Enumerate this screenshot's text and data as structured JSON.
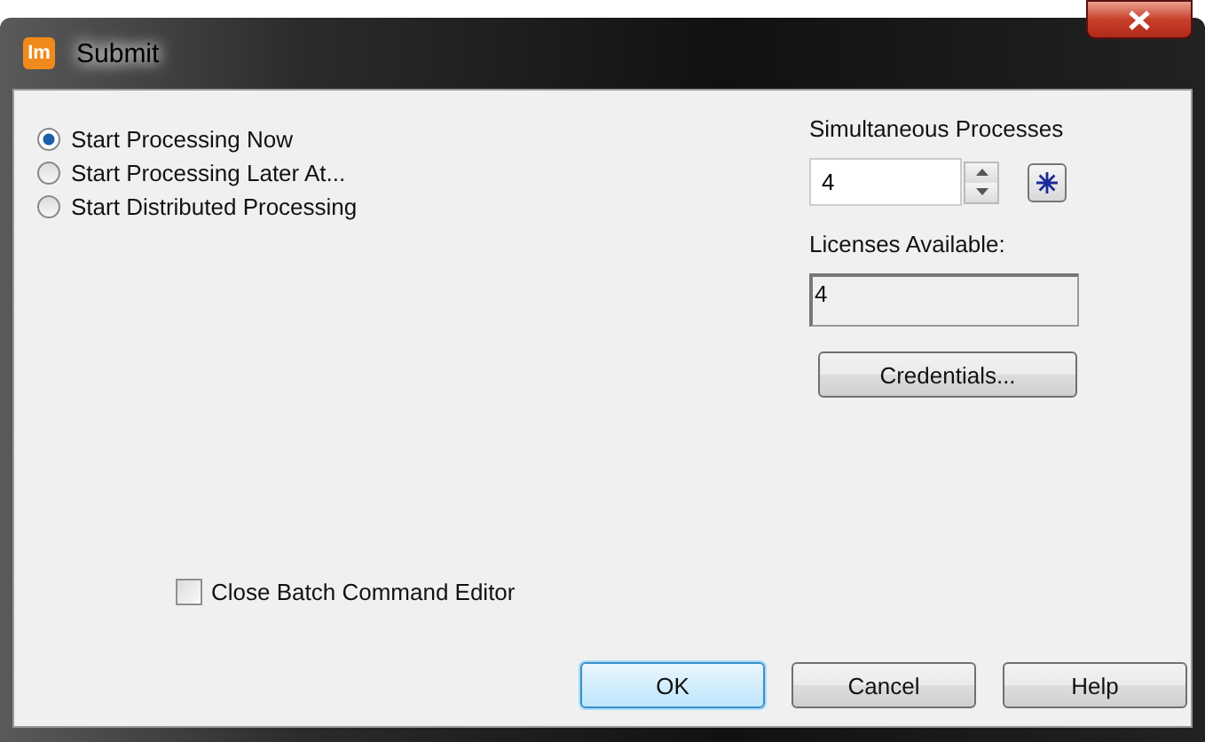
{
  "window": {
    "title": "Submit",
    "app_icon": "Im"
  },
  "processing_options": [
    {
      "label": "Start Processing Now",
      "selected": true
    },
    {
      "label": "Start Processing Later At...",
      "selected": false
    },
    {
      "label": "Start Distributed Processing",
      "selected": false
    }
  ],
  "simultaneous_processes": {
    "label": "Simultaneous Processes",
    "value": "4"
  },
  "licenses_available": {
    "label": "Licenses Available:",
    "value": "4"
  },
  "credentials_button": "Credentials...",
  "close_editor": {
    "label": "Close Batch Command Editor",
    "checked": false
  },
  "buttons": [
    {
      "label": "OK",
      "default": true
    },
    {
      "label": "Cancel",
      "default": false
    },
    {
      "label": "Help",
      "default": false
    }
  ]
}
